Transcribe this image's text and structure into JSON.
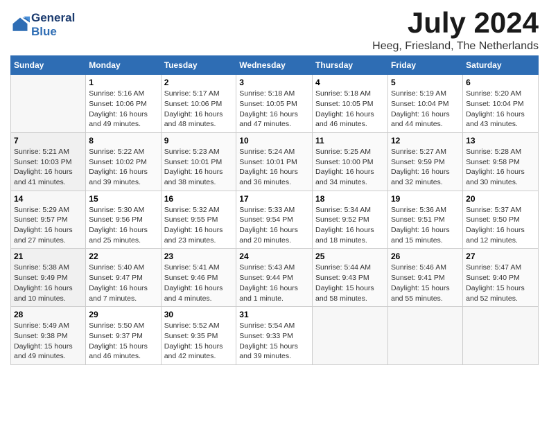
{
  "header": {
    "logo_line1": "General",
    "logo_line2": "Blue",
    "month_year": "July 2024",
    "location": "Heeg, Friesland, The Netherlands"
  },
  "weekdays": [
    "Sunday",
    "Monday",
    "Tuesday",
    "Wednesday",
    "Thursday",
    "Friday",
    "Saturday"
  ],
  "weeks": [
    [
      {
        "day": "",
        "info": ""
      },
      {
        "day": "1",
        "info": "Sunrise: 5:16 AM\nSunset: 10:06 PM\nDaylight: 16 hours\nand 49 minutes."
      },
      {
        "day": "2",
        "info": "Sunrise: 5:17 AM\nSunset: 10:06 PM\nDaylight: 16 hours\nand 48 minutes."
      },
      {
        "day": "3",
        "info": "Sunrise: 5:18 AM\nSunset: 10:05 PM\nDaylight: 16 hours\nand 47 minutes."
      },
      {
        "day": "4",
        "info": "Sunrise: 5:18 AM\nSunset: 10:05 PM\nDaylight: 16 hours\nand 46 minutes."
      },
      {
        "day": "5",
        "info": "Sunrise: 5:19 AM\nSunset: 10:04 PM\nDaylight: 16 hours\nand 44 minutes."
      },
      {
        "day": "6",
        "info": "Sunrise: 5:20 AM\nSunset: 10:04 PM\nDaylight: 16 hours\nand 43 minutes."
      }
    ],
    [
      {
        "day": "7",
        "info": "Sunrise: 5:21 AM\nSunset: 10:03 PM\nDaylight: 16 hours\nand 41 minutes."
      },
      {
        "day": "8",
        "info": "Sunrise: 5:22 AM\nSunset: 10:02 PM\nDaylight: 16 hours\nand 39 minutes."
      },
      {
        "day": "9",
        "info": "Sunrise: 5:23 AM\nSunset: 10:01 PM\nDaylight: 16 hours\nand 38 minutes."
      },
      {
        "day": "10",
        "info": "Sunrise: 5:24 AM\nSunset: 10:01 PM\nDaylight: 16 hours\nand 36 minutes."
      },
      {
        "day": "11",
        "info": "Sunrise: 5:25 AM\nSunset: 10:00 PM\nDaylight: 16 hours\nand 34 minutes."
      },
      {
        "day": "12",
        "info": "Sunrise: 5:27 AM\nSunset: 9:59 PM\nDaylight: 16 hours\nand 32 minutes."
      },
      {
        "day": "13",
        "info": "Sunrise: 5:28 AM\nSunset: 9:58 PM\nDaylight: 16 hours\nand 30 minutes."
      }
    ],
    [
      {
        "day": "14",
        "info": "Sunrise: 5:29 AM\nSunset: 9:57 PM\nDaylight: 16 hours\nand 27 minutes."
      },
      {
        "day": "15",
        "info": "Sunrise: 5:30 AM\nSunset: 9:56 PM\nDaylight: 16 hours\nand 25 minutes."
      },
      {
        "day": "16",
        "info": "Sunrise: 5:32 AM\nSunset: 9:55 PM\nDaylight: 16 hours\nand 23 minutes."
      },
      {
        "day": "17",
        "info": "Sunrise: 5:33 AM\nSunset: 9:54 PM\nDaylight: 16 hours\nand 20 minutes."
      },
      {
        "day": "18",
        "info": "Sunrise: 5:34 AM\nSunset: 9:52 PM\nDaylight: 16 hours\nand 18 minutes."
      },
      {
        "day": "19",
        "info": "Sunrise: 5:36 AM\nSunset: 9:51 PM\nDaylight: 16 hours\nand 15 minutes."
      },
      {
        "day": "20",
        "info": "Sunrise: 5:37 AM\nSunset: 9:50 PM\nDaylight: 16 hours\nand 12 minutes."
      }
    ],
    [
      {
        "day": "21",
        "info": "Sunrise: 5:38 AM\nSunset: 9:49 PM\nDaylight: 16 hours\nand 10 minutes."
      },
      {
        "day": "22",
        "info": "Sunrise: 5:40 AM\nSunset: 9:47 PM\nDaylight: 16 hours\nand 7 minutes."
      },
      {
        "day": "23",
        "info": "Sunrise: 5:41 AM\nSunset: 9:46 PM\nDaylight: 16 hours\nand 4 minutes."
      },
      {
        "day": "24",
        "info": "Sunrise: 5:43 AM\nSunset: 9:44 PM\nDaylight: 16 hours\nand 1 minute."
      },
      {
        "day": "25",
        "info": "Sunrise: 5:44 AM\nSunset: 9:43 PM\nDaylight: 15 hours\nand 58 minutes."
      },
      {
        "day": "26",
        "info": "Sunrise: 5:46 AM\nSunset: 9:41 PM\nDaylight: 15 hours\nand 55 minutes."
      },
      {
        "day": "27",
        "info": "Sunrise: 5:47 AM\nSunset: 9:40 PM\nDaylight: 15 hours\nand 52 minutes."
      }
    ],
    [
      {
        "day": "28",
        "info": "Sunrise: 5:49 AM\nSunset: 9:38 PM\nDaylight: 15 hours\nand 49 minutes."
      },
      {
        "day": "29",
        "info": "Sunrise: 5:50 AM\nSunset: 9:37 PM\nDaylight: 15 hours\nand 46 minutes."
      },
      {
        "day": "30",
        "info": "Sunrise: 5:52 AM\nSunset: 9:35 PM\nDaylight: 15 hours\nand 42 minutes."
      },
      {
        "day": "31",
        "info": "Sunrise: 5:54 AM\nSunset: 9:33 PM\nDaylight: 15 hours\nand 39 minutes."
      },
      {
        "day": "",
        "info": ""
      },
      {
        "day": "",
        "info": ""
      },
      {
        "day": "",
        "info": ""
      }
    ]
  ]
}
